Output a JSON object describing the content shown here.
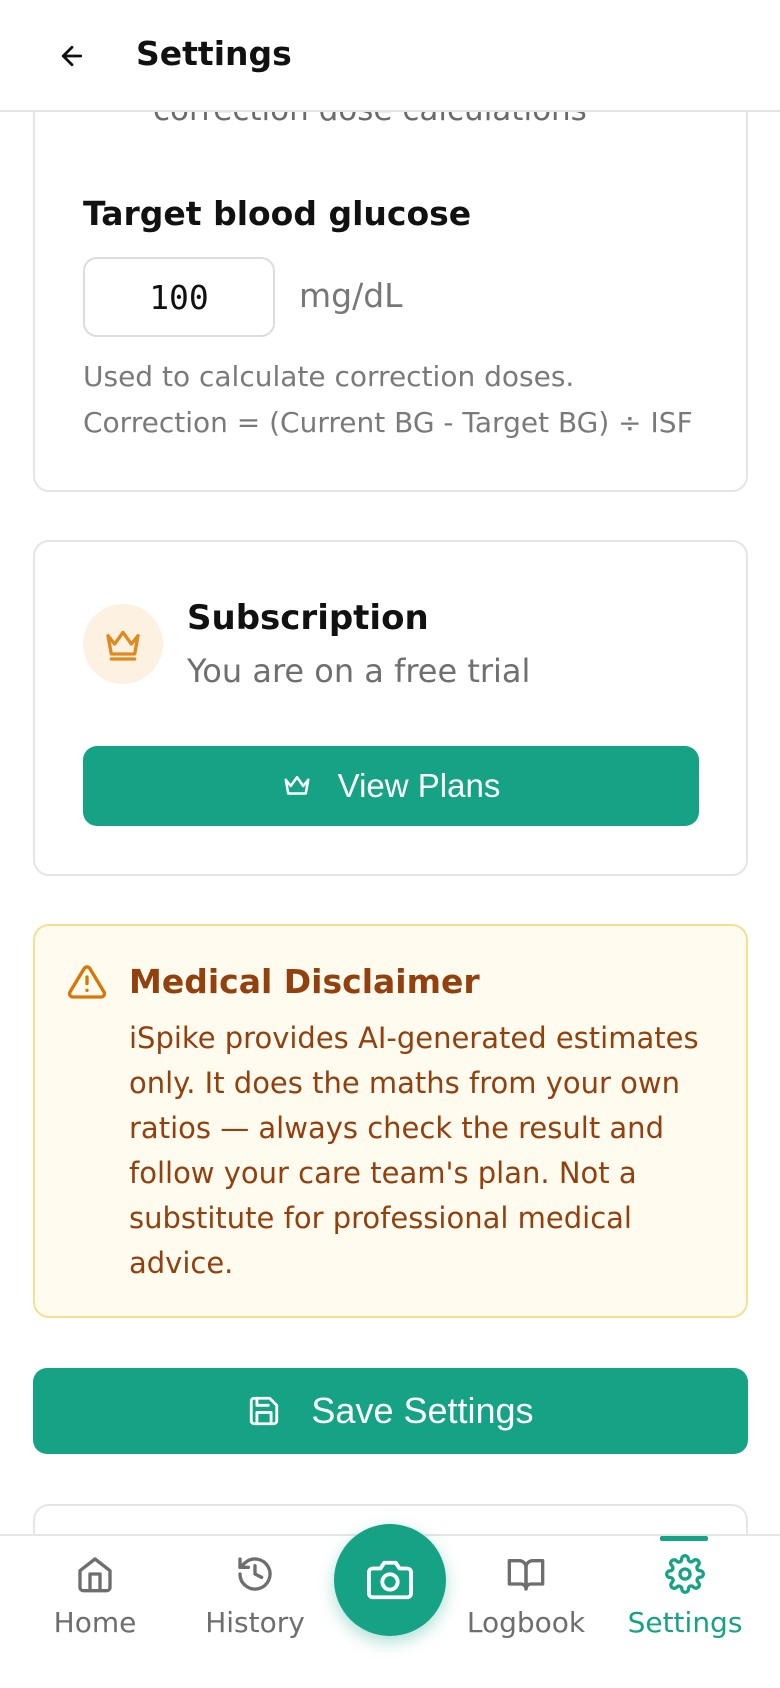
{
  "header": {
    "title": "Settings"
  },
  "target_card": {
    "partial_text": "correction dose calculations",
    "label": "Target blood glucose",
    "value": "100",
    "unit": "mg/dL",
    "hint_line1": "Used to calculate correction doses.",
    "hint_line2": "Correction = (Current BG - Target BG) ÷ ISF"
  },
  "subscription": {
    "title": "Subscription",
    "status": "You are on a free trial",
    "button_label": "View Plans"
  },
  "disclaimer": {
    "title": "Medical Disclaimer",
    "body": "iSpike provides AI-generated estimates only. It does the maths from your own ratios — always check the result and follow your care team's plan. Not a substitute for professional medical advice."
  },
  "save_button": {
    "label": "Save Settings"
  },
  "nav": {
    "items": [
      {
        "label": "Home",
        "icon": "home-icon"
      },
      {
        "label": "History",
        "icon": "history-icon"
      },
      {
        "label": "Logbook",
        "icon": "book-icon"
      },
      {
        "label": "Settings",
        "icon": "gear-icon",
        "active": true
      }
    ],
    "center_icon": "camera-icon"
  },
  "colors": {
    "accent": "#16a385",
    "warning_text": "#93400f",
    "warning_bg": "#fffbef",
    "crown": "#e08a1e"
  }
}
